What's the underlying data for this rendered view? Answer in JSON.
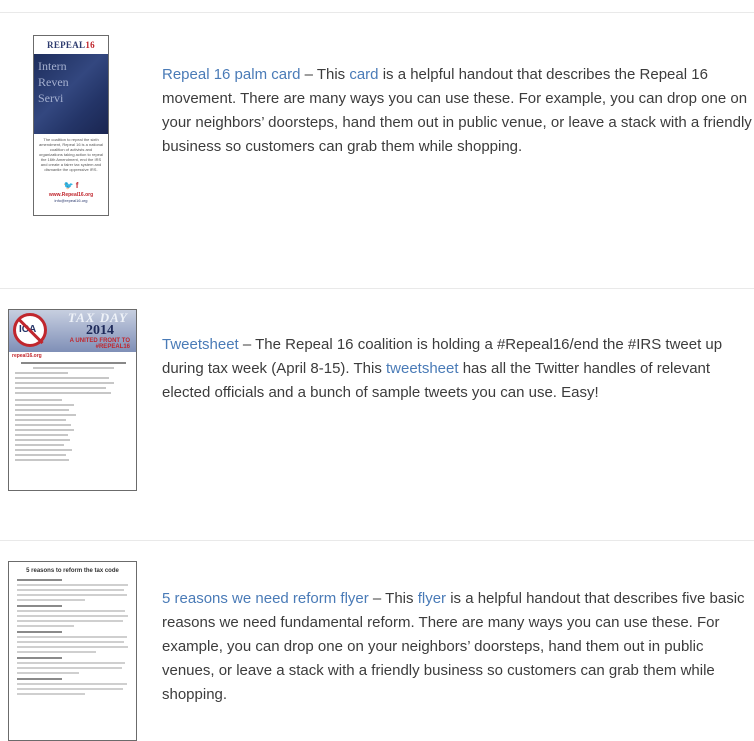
{
  "items": [
    {
      "link_title": "Repeal 16 palm card",
      "sep": " – This ",
      "link_inline": "card",
      "text": " is a helpful handout that describes the Repeal 16 movement. There are many ways you can use these. For example, you can drop one on your neighbors’ doorsteps, hand them out in public venue, or leave a stack with a friendly business so customers can grab them while shopping.",
      "thumb": {
        "header_main": "REPEAL",
        "header_num": "16",
        "photo_words": [
          "Intern",
          "Reven",
          "Servi"
        ],
        "body": "The coalition to repeal the sixth amendment, Repeal 16 is a national coalition of activists and organizations taking action to repeal the 16th Amendment, end the IRS and create a fairer tax system and dismantle the oppressive IRS.",
        "social": "🐦 f",
        "url": "www.Repeal16.org",
        "mail": "info@repeal16.org"
      }
    },
    {
      "link_title": "Tweetsheet",
      "sep": " – The Repeal 16 coalition is holding a #Repeal16/end the #IRS tweet up during tax week (April 8-15). This ",
      "link_inline": "tweetsheet",
      "text": " has all the Twitter handles of relevant elected officials and a bunch of sample tweets you can use. Easy!",
      "thumb": {
        "taxday": "TAX DAY",
        "year": "2014",
        "front_line1": "A UNITED FRONT TO",
        "front_line2": "#REPEAL16",
        "site": "repeal16.org"
      }
    },
    {
      "link_title": "5 reasons we need reform flyer",
      "sep": " – This ",
      "link_inline": "flyer",
      "text": " is a helpful handout that describes five basic reasons we need fundamental reform. There are many ways you can use these. For example, you can drop one on your neighbors’ doorsteps, hand them out in public venues, or leave a stack with a friendly business so customers can grab them while shopping.",
      "thumb": {
        "title": "5 reasons to reform the tax code"
      }
    }
  ],
  "colors": {
    "link": "#4a7bb7",
    "text": "#3c3c3c",
    "rule": "#e9e9e9",
    "brand_red": "#c0262d",
    "brand_navy": "#243568"
  }
}
